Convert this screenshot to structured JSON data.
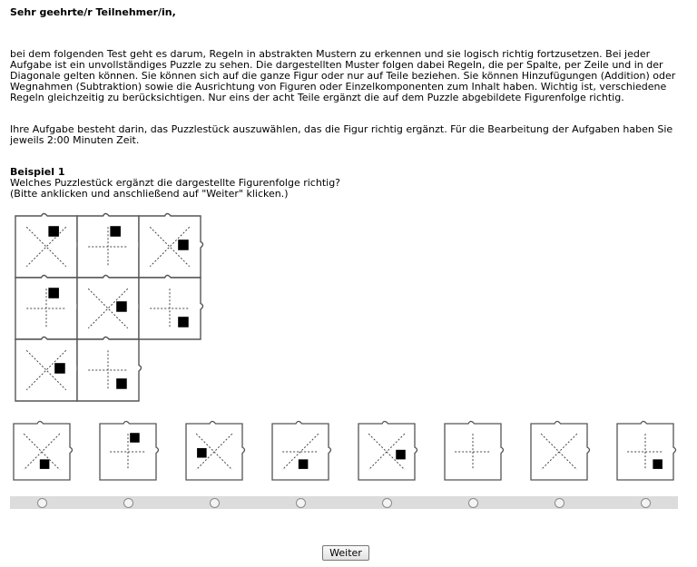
{
  "intro": {
    "greeting": "Sehr geehrte/r Teilnehmer/in,",
    "paragraph1": "bei dem folgenden Test geht es darum, Regeln in abstrakten Mustern zu erkennen und sie logisch richtig fortzusetzen. Bei jeder Aufgabe ist ein unvollständiges Puzzle zu sehen. Die dargestellten Muster folgen dabei Regeln, die per Spalte, per Zeile und in der Diagonale gelten können. Sie können sich auf die ganze Figur oder nur auf Teile beziehen. Sie können Hinzufügungen (Addition) oder Wegnahmen (Subtraktion) sowie die Ausrichtung von Figuren oder Einzelkomponenten zum Inhalt haben. Wichtig ist, verschiedene Regeln gleichzeitig zu berücksichtigen. Nur eins der acht Teile ergänzt die auf dem Puzzle abgebildete Figurenfolge richtig.",
    "paragraph2": "Ihre Aufgabe besteht darin, das Puzzlestück auszuwählen, das die Figur richtig ergänzt. Für die Bearbeitung der Aufgaben haben Sie jeweils 2:00 Minuten Zeit."
  },
  "example": {
    "title": "Beispiel 1",
    "question": "Welches Puzzlestück ergänzt die dargestellte Figurenfolge richtig?",
    "hint": "(Bitte anklicken und anschließend auf \"Weiter\" klicken.)"
  },
  "puzzle_grid": [
    {
      "row": 1,
      "col": 1,
      "lines": "x",
      "square": "top-right"
    },
    {
      "row": 1,
      "col": 2,
      "lines": "plus",
      "square": "top-right"
    },
    {
      "row": 1,
      "col": 3,
      "lines": "x",
      "square": "mid-right"
    },
    {
      "row": 2,
      "col": 1,
      "lines": "plus",
      "square": "top-right"
    },
    {
      "row": 2,
      "col": 2,
      "lines": "x",
      "square": "mid-right"
    },
    {
      "row": 2,
      "col": 3,
      "lines": "plus",
      "square": "bottom-right"
    },
    {
      "row": 3,
      "col": 1,
      "lines": "x",
      "square": "mid-right"
    },
    {
      "row": 3,
      "col": 2,
      "lines": "plus",
      "square": "bottom-right"
    },
    {
      "row": 3,
      "col": 3,
      "lines": "missing",
      "square": "none"
    }
  ],
  "options": [
    {
      "index": 1,
      "lines": "x",
      "square": "bottom-center"
    },
    {
      "index": 2,
      "lines": "plus",
      "square": "top-right"
    },
    {
      "index": 3,
      "lines": "x",
      "square": "left-center"
    },
    {
      "index": 4,
      "lines": "diagonal",
      "square": "bottom-center"
    },
    {
      "index": 5,
      "lines": "x",
      "square": "right-center"
    },
    {
      "index": 6,
      "lines": "plus",
      "square": "none"
    },
    {
      "index": 7,
      "lines": "x",
      "square": "none"
    },
    {
      "index": 8,
      "lines": "plus",
      "square": "bottom-right"
    }
  ],
  "selected_option": null,
  "next_button": "Weiter",
  "colors": {
    "radio_bar": "#dcdcdc",
    "ink": "#000000"
  }
}
